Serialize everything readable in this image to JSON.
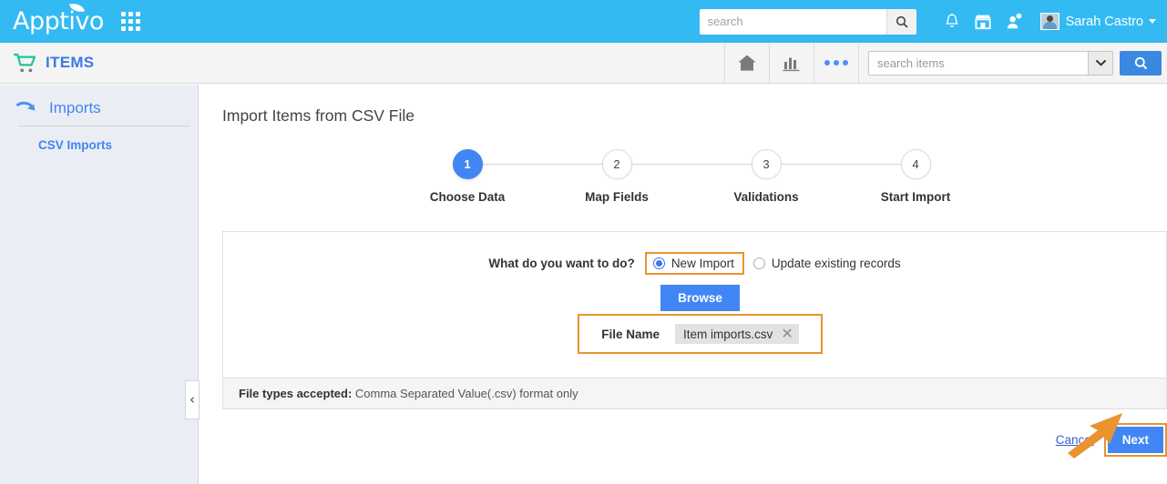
{
  "topbar": {
    "brand": "Apptivo",
    "apps_grid_icon": "grid-apps-icon",
    "search": {
      "placeholder": "search",
      "value": ""
    },
    "search_icon": "search-icon",
    "notifications_icon": "bell-icon",
    "store_icon": "store-icon",
    "contact_icon": "person-add-icon",
    "avatar_icon": "user-avatar",
    "user_name": "Sarah Castro",
    "caret_icon": "chevron-down-icon"
  },
  "subbar": {
    "app_icon": "shopping-cart-icon",
    "app_name": "ITEMS",
    "home_icon": "home-icon",
    "reports_icon": "bar-chart-icon",
    "more_icon": "three-dots-icon",
    "items_search": {
      "placeholder": "search items",
      "value": ""
    },
    "dropdown_icon": "chevron-down-icon",
    "search_button_icon": "search-icon"
  },
  "sidebar": {
    "header": {
      "icon": "curved-arrow-icon",
      "label": "Imports"
    },
    "items": [
      {
        "label": "CSV Imports"
      }
    ],
    "collapse_icon": "chevron-left-icon"
  },
  "main": {
    "page_title": "Import Items from CSV File",
    "steps": [
      {
        "number": "1",
        "label": "Choose Data",
        "active": true
      },
      {
        "number": "2",
        "label": "Map Fields",
        "active": false
      },
      {
        "number": "3",
        "label": "Validations",
        "active": false
      },
      {
        "number": "4",
        "label": "Start Import",
        "active": false
      }
    ],
    "question_label": "What do you want to do?",
    "options": [
      {
        "label": "New Import",
        "selected": true
      },
      {
        "label": "Update existing records",
        "selected": false
      }
    ],
    "browse_label": "Browse",
    "file_name_label": "File Name",
    "file_name_value": "Item imports.csv",
    "file_remove_icon": "close-icon",
    "file_types_prefix": "File types accepted:",
    "file_types_text": "Comma Separated Value(.csv) format only",
    "cancel_label": "Cancel",
    "next_label": "Next"
  },
  "annotation": {
    "arrow_icon": "pointer-arrow-icon",
    "highlight_color": "#e8942f",
    "accent_color": "#4285f4",
    "header_color": "#33baf2"
  }
}
